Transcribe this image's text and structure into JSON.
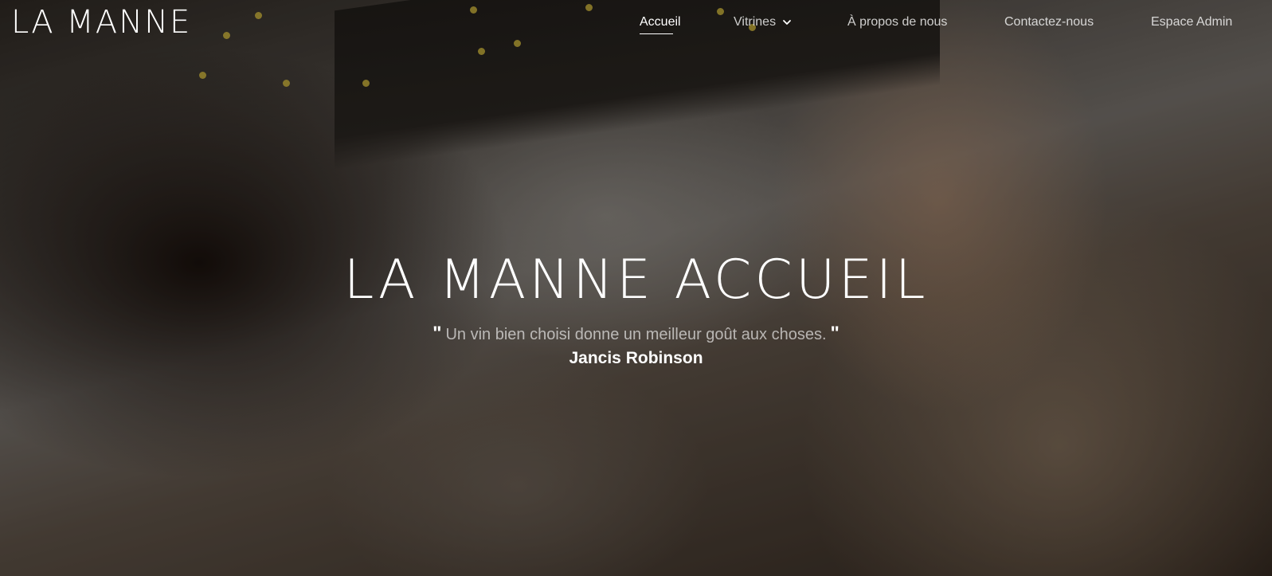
{
  "header": {
    "logo_text": "LA MANNE",
    "nav": [
      {
        "label": "Accueil",
        "active": true
      },
      {
        "label": "Vitrines",
        "has_dropdown": true,
        "icon": "chevron-down-icon"
      },
      {
        "label": "À propos de nous"
      },
      {
        "label": "Contactez-nous"
      },
      {
        "label": "Espace Admin"
      }
    ]
  },
  "hero": {
    "title": "LA MANNE ACCUEIL",
    "quote_open": "\"",
    "quote_text": "Un vin bien choisi donne un meilleur goût aux choses.",
    "quote_close": "\"",
    "author": "Jancis Robinson"
  },
  "colors": {
    "text": "#ffffff",
    "nav_inactive": "#c8c8c8",
    "confetti": "#c9b23a"
  }
}
